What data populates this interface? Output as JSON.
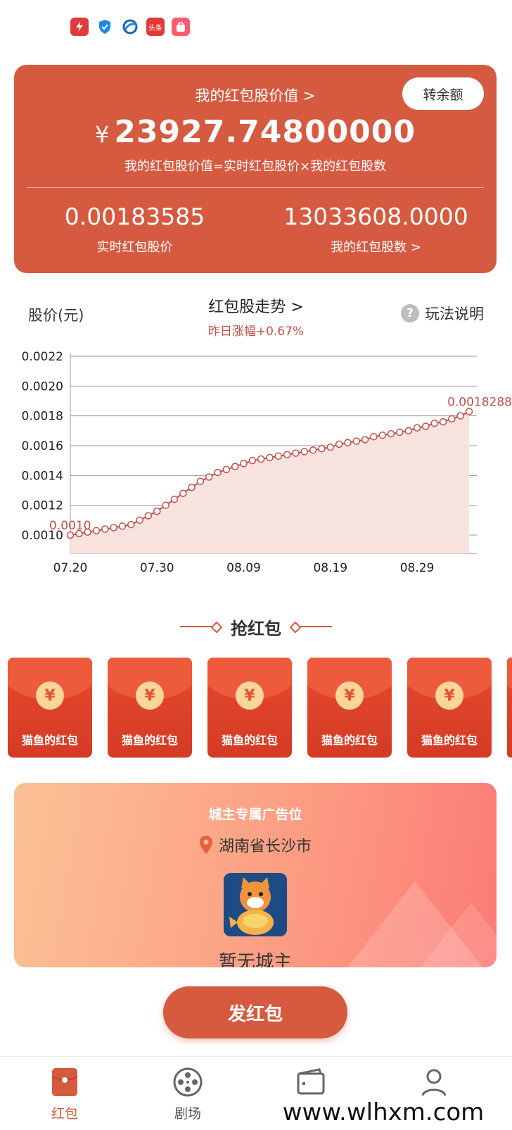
{
  "status_bar": {
    "icons": [
      "app-red-icon",
      "shield-icon",
      "browser-icon",
      "toutiao-icon",
      "shopping-bag-icon"
    ],
    "toutiao_text": "头条"
  },
  "balance_card": {
    "transfer_label": "转余额",
    "title": "我的红包股价值 >",
    "currency": "¥",
    "value": "23927.74800000",
    "formula": "我的红包股价值=实时红包股价×我的红包股数",
    "price_value": "0.00183585",
    "price_label": "实时红包股价",
    "shares_value": "13033608.0000",
    "shares_label": "我的红包股数 >",
    "color": "#d65a40"
  },
  "trend": {
    "price_unit": "股价(元)",
    "title": "红包股走势 >",
    "change": "昨日涨幅+0.67%",
    "howto_label": "玩法说明",
    "help_glyph": "?"
  },
  "chart_data": {
    "type": "area",
    "x_ticks": [
      "07.20",
      "07.30",
      "08.09",
      "08.19",
      "08.29"
    ],
    "y_ticks": [
      "0.0010",
      "0.0012",
      "0.0014",
      "0.0016",
      "0.0018",
      "0.0020",
      "0.0022"
    ],
    "ylim": [
      0.001,
      0.0022
    ],
    "first_label": "0.0010",
    "last_label": "0.0018288",
    "x": [
      "07.20",
      "07.21",
      "07.22",
      "07.23",
      "07.24",
      "07.25",
      "07.26",
      "07.27",
      "07.28",
      "07.29",
      "07.30",
      "07.31",
      "08.01",
      "08.02",
      "08.03",
      "08.04",
      "08.05",
      "08.06",
      "08.07",
      "08.08",
      "08.09",
      "08.10",
      "08.11",
      "08.12",
      "08.13",
      "08.14",
      "08.15",
      "08.16",
      "08.17",
      "08.18",
      "08.19",
      "08.20",
      "08.21",
      "08.22",
      "08.23",
      "08.24",
      "08.25",
      "08.26",
      "08.27",
      "08.28",
      "08.29",
      "08.30",
      "08.31",
      "09.01",
      "09.02",
      "09.03",
      "09.04"
    ],
    "values": [
      0.001,
      0.00101,
      0.00102,
      0.00103,
      0.00104,
      0.00105,
      0.00106,
      0.00107,
      0.0011,
      0.00113,
      0.00116,
      0.0012,
      0.00124,
      0.00128,
      0.00132,
      0.00136,
      0.00139,
      0.00142,
      0.00144,
      0.00146,
      0.00148,
      0.0015,
      0.00151,
      0.00152,
      0.00153,
      0.00154,
      0.00155,
      0.00156,
      0.00157,
      0.00158,
      0.00159,
      0.00161,
      0.00162,
      0.00163,
      0.00164,
      0.00166,
      0.00167,
      0.00168,
      0.00169,
      0.0017,
      0.00172,
      0.00173,
      0.00175,
      0.00176,
      0.00178,
      0.0018,
      0.00182885
    ],
    "line_color": "#c0504a",
    "fill_color": "#f8e3de",
    "grid": true
  },
  "grab": {
    "title": "抢红包",
    "envelopes": [
      {
        "label": "猫鱼的红包",
        "glyph": "¥"
      },
      {
        "label": "猫鱼的红包",
        "glyph": "¥"
      },
      {
        "label": "猫鱼的红包",
        "glyph": "¥"
      },
      {
        "label": "猫鱼的红包",
        "glyph": "¥"
      },
      {
        "label": "猫鱼的红包",
        "glyph": "¥"
      }
    ]
  },
  "city": {
    "title": "城主专属广告位",
    "location": "湖南省长沙市",
    "owner": "暂无城主"
  },
  "send_button": "发红包",
  "bottom_nav": {
    "items": [
      {
        "label": "红包",
        "icon": "red-envelope-icon",
        "active": true
      },
      {
        "label": "剧场",
        "icon": "film-reel-icon",
        "active": false
      },
      {
        "label": "",
        "icon": "wallet-icon",
        "active": false
      },
      {
        "label": "",
        "icon": "user-icon",
        "active": false
      }
    ]
  },
  "watermark": "www.wlhxm.com"
}
